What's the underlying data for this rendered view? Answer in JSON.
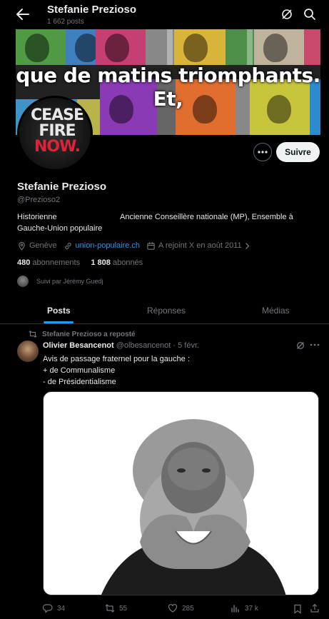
{
  "header": {
    "title": "Stefanie Prezioso",
    "posts_count": "1 662 posts"
  },
  "banner": {
    "overlay_text": "que de matins triomphants. Et,"
  },
  "avatar": {
    "line1": "CEASE",
    "line2": "FIRE",
    "line3": "NOW."
  },
  "profile": {
    "follow_label": "Suivre",
    "name": "Stefanie Prezioso",
    "handle": "@Prezioso2",
    "bio_part1": "Historienne",
    "bio_part2": "Ancienne Conseillère nationale (MP), Ensemble à",
    "bio_part3": "Gauche-Union populaire",
    "location": "Genève",
    "website": "union-populaire.ch",
    "joined": "A rejoint X en août 2011",
    "following_count": "480",
    "following_label": "abonnements",
    "followers_count": "1 808",
    "followers_label": "abonnés",
    "followed_by": "Suivi par Jérémy Guedj"
  },
  "tabs": [
    {
      "label": "Posts",
      "active": true
    },
    {
      "label": "Réponses",
      "active": false
    },
    {
      "label": "Médias",
      "active": false
    }
  ],
  "post": {
    "repost_label": "Stefanie Prezioso a reposté",
    "author_name": "Olivier Besancenot",
    "author_handle": "@olbesancenot",
    "date": " · 5 févr.",
    "text_line1": "Avis de passage fraternel pour la gauche :",
    "text_line2": "+ de Communalisme",
    "text_line3": "- de Présidentialisme",
    "replies": "34",
    "reposts": "55",
    "likes": "285",
    "views": "37 k"
  },
  "colors": {
    "background": "#000000",
    "accent": "#1d9bf0",
    "text": "#e7e9ea",
    "muted": "#71767b",
    "repost_green": "#00ba7c"
  }
}
